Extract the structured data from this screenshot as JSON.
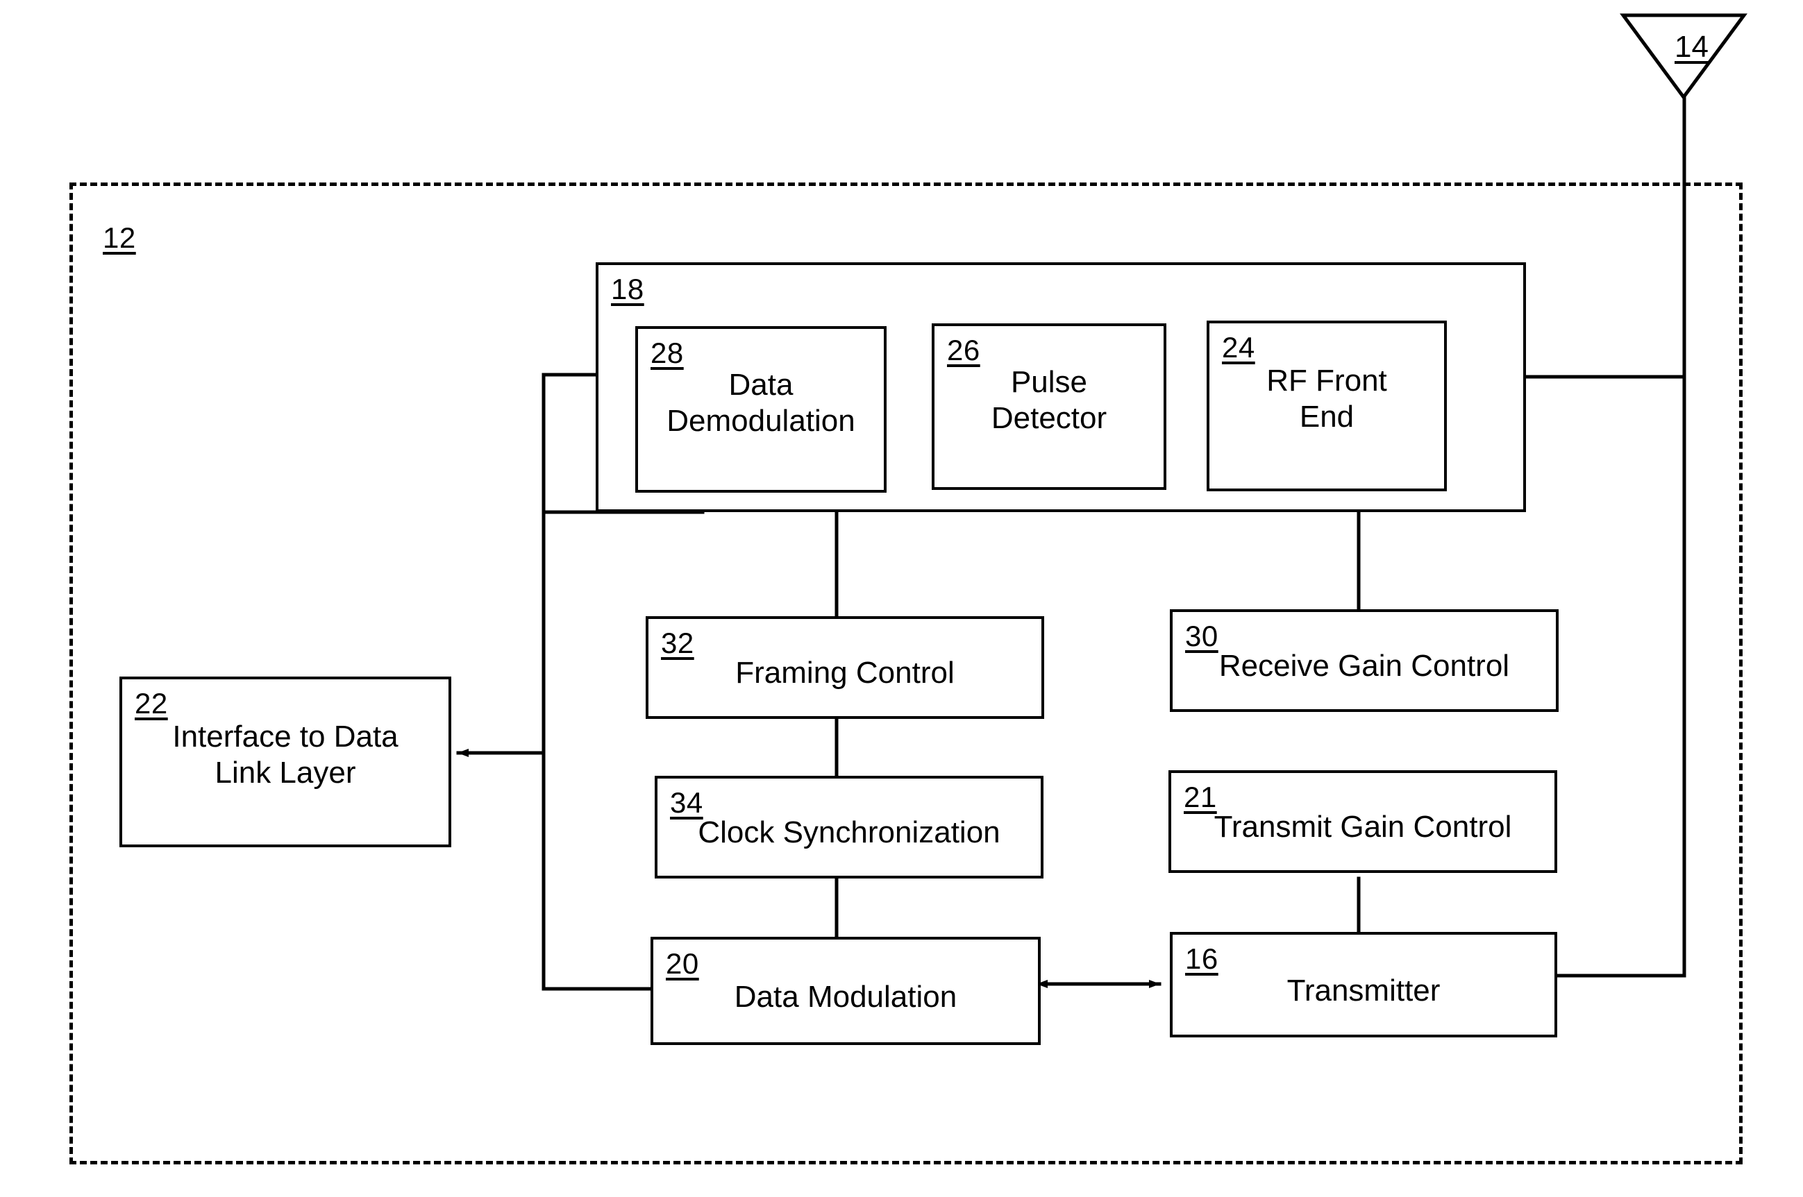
{
  "figure": {
    "type": "patent-block-diagram",
    "antenna": {
      "ref": "14",
      "name": "antenna"
    },
    "enclosure": {
      "ref": "12",
      "name": "transceiver-enclosure"
    },
    "receiver_group": {
      "ref": "18",
      "name": "receiver"
    },
    "blocks": [
      {
        "ref": "28",
        "label": "Data\nDemodulation",
        "name": "data-demodulation"
      },
      {
        "ref": "26",
        "label": "Pulse\nDetector",
        "name": "pulse-detector"
      },
      {
        "ref": "24",
        "label": "RF Front\nEnd",
        "name": "rf-front-end"
      },
      {
        "ref": "32",
        "label": "Framing Control",
        "name": "framing-control"
      },
      {
        "ref": "30",
        "label": "Receive Gain Control",
        "name": "receive-gain-control"
      },
      {
        "ref": "34",
        "label": "Clock Synchronization",
        "name": "clock-synchronization"
      },
      {
        "ref": "21",
        "label": "Transmit Gain Control",
        "name": "transmit-gain-control"
      },
      {
        "ref": "20",
        "label": "Data Modulation",
        "name": "data-modulation"
      },
      {
        "ref": "16",
        "label": "Transmitter",
        "name": "transmitter"
      },
      {
        "ref": "22",
        "label": "Interface to Data\nLink Layer",
        "name": "interface-to-data-link-layer"
      }
    ],
    "colors": {
      "line": "#000000",
      "background": "#ffffff"
    }
  }
}
